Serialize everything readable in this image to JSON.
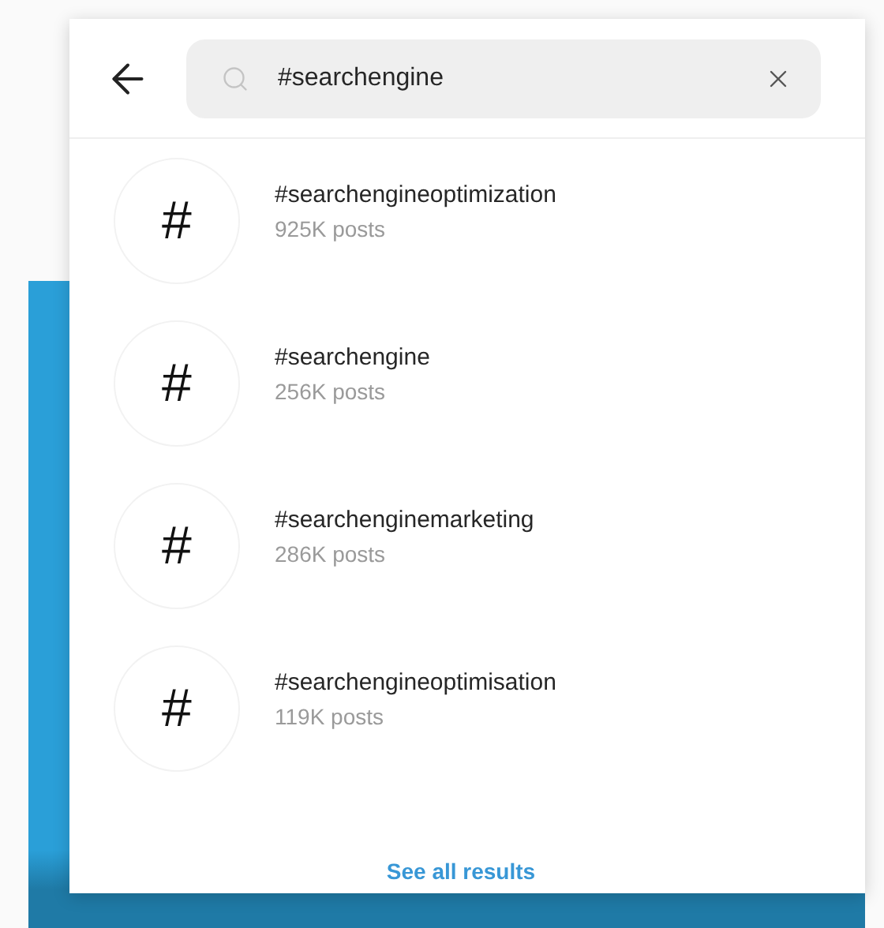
{
  "search": {
    "value": "#searchengine"
  },
  "results": [
    {
      "symbol": "#",
      "tag": "#searchengineoptimization",
      "posts": "925K posts"
    },
    {
      "symbol": "#",
      "tag": "#searchengine",
      "posts": "256K posts"
    },
    {
      "symbol": "#",
      "tag": "#searchenginemarketing",
      "posts": "286K posts"
    },
    {
      "symbol": "#",
      "tag": "#searchengineoptimisation",
      "posts": "119K posts"
    }
  ],
  "footer_link": "See all results"
}
